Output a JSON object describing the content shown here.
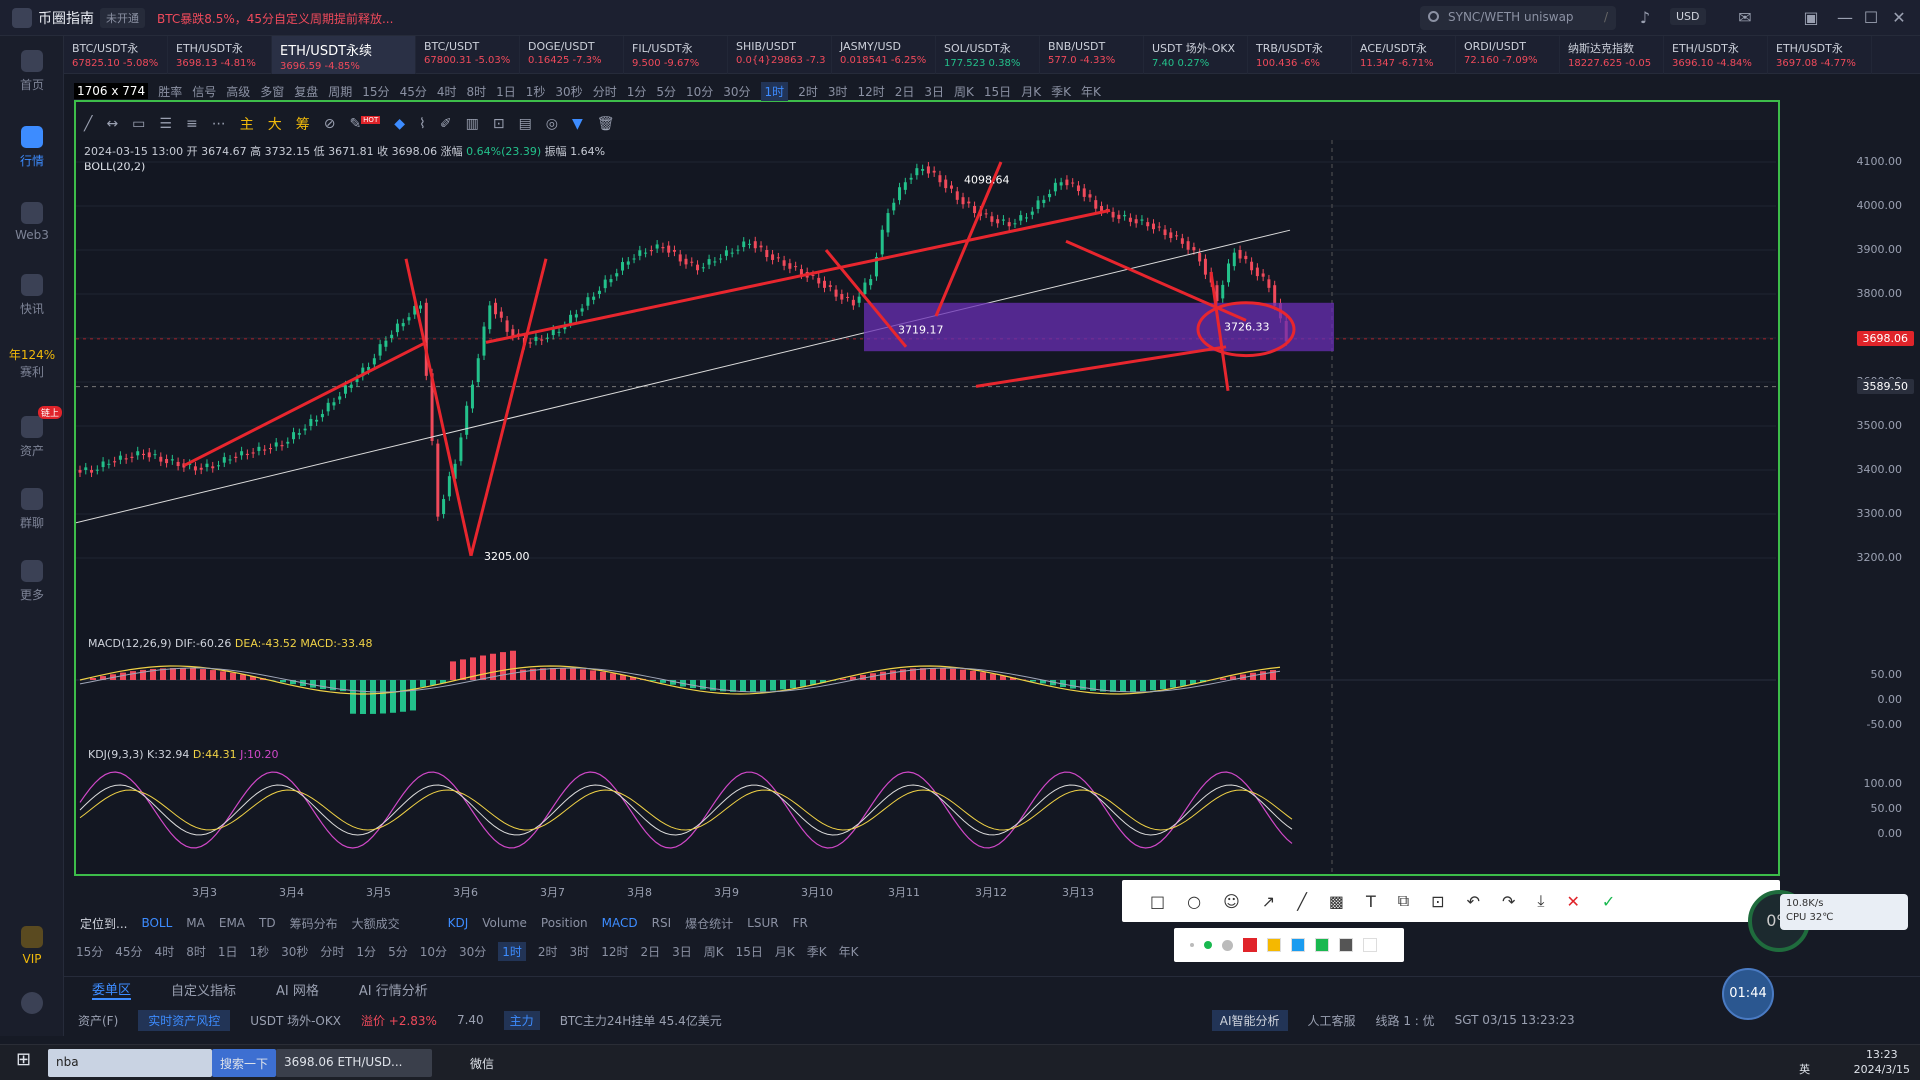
{
  "app": {
    "title": "币圈指南",
    "status": "未开通",
    "news": "BTC暴跌8.5%，45分自定义周期提前释放...",
    "search_placeholder": "SYNC/WETH uniswap",
    "search_shortcut": "/",
    "currency": "USD"
  },
  "nav": [
    {
      "label": "首页",
      "icon": "home-icon"
    },
    {
      "label": "行情",
      "icon": "chart-icon",
      "active": true
    },
    {
      "label": "Web3",
      "icon": "web3-icon"
    },
    {
      "label": "快讯",
      "icon": "news-icon"
    },
    {
      "label": "年124%",
      "sub": "赛利",
      "icon": "apy-icon"
    },
    {
      "label": "资产",
      "icon": "wallet-icon",
      "badge": "链上"
    },
    {
      "label": "群聊",
      "icon": "chat-icon"
    },
    {
      "label": "更多",
      "icon": "grid-icon"
    },
    {
      "label": "VIP",
      "icon": "vip-icon"
    }
  ],
  "tabs": [
    {
      "name": "BTC/USDT永",
      "price": "67825.10",
      "change": "-5.08%",
      "dir": "dn"
    },
    {
      "name": "ETH/USDT永",
      "price": "3698.13",
      "change": "-4.81%",
      "dir": "dn"
    },
    {
      "name": "ETH/USDT永续",
      "price": "3696.59",
      "change": "-4.85%",
      "dir": "dn",
      "active": true
    },
    {
      "name": "BTC/USDT",
      "price": "67800.31",
      "change": "-5.03%",
      "dir": "dn"
    },
    {
      "name": "DOGE/USDT",
      "price": "0.16425",
      "change": "-7.3%",
      "dir": "dn"
    },
    {
      "name": "FIL/USDT永",
      "price": "9.500",
      "change": "-9.67%",
      "dir": "dn"
    },
    {
      "name": "SHIB/USDT",
      "price": "0.0{4}29863",
      "change": "-7.3",
      "dir": "dn"
    },
    {
      "name": "JASMY/USD",
      "price": "0.018541",
      "change": "-6.25%",
      "dir": "dn"
    },
    {
      "name": "SOL/USDT永",
      "price": "177.523",
      "change": "0.38%",
      "dir": "up"
    },
    {
      "name": "BNB/USDT",
      "price": "577.0",
      "change": "-4.33%",
      "dir": "dn"
    },
    {
      "name": "USDT 场外-OKX",
      "price": "7.40",
      "change": "0.27%",
      "dir": "up"
    },
    {
      "name": "TRB/USDT永",
      "price": "100.436",
      "change": "-6%",
      "dir": "dn"
    },
    {
      "name": "ACE/USDT永",
      "price": "11.347",
      "change": "-6.71%",
      "dir": "dn"
    },
    {
      "name": "ORDI/USDT",
      "price": "72.160",
      "change": "-7.09%",
      "dir": "dn"
    },
    {
      "name": "纳斯达克指数",
      "price": "18227.625",
      "change": "-0.05",
      "dir": "dn"
    },
    {
      "name": "ETH/USDT永",
      "price": "3696.10",
      "change": "-4.84%",
      "dir": "dn"
    },
    {
      "name": "ETH/USDT永",
      "price": "3697.08",
      "change": "-4.77%",
      "dir": "dn"
    }
  ],
  "toolbar": {
    "size": "1706 x 774",
    "items": [
      "胜率",
      "信号",
      "高级",
      "多窗",
      "复盘",
      "周期"
    ],
    "periods": [
      "15分",
      "45分",
      "4时",
      "8时",
      "1日",
      "1秒",
      "30秒",
      "分时",
      "1分",
      "5分",
      "10分",
      "30分",
      "1时",
      "2时",
      "3时",
      "12时",
      "2日",
      "3日",
      "周K",
      "15日",
      "月K",
      "季K",
      "年K"
    ],
    "selected_period": "1时",
    "draw_labels": [
      "主",
      "大",
      "筹"
    ],
    "hot": "HOT"
  },
  "ohlc": {
    "date": "2024-03-15 13:00",
    "open": "3674.67",
    "high": "3732.15",
    "low": "3671.81",
    "close": "3698.06",
    "change": "0.64%(23.39)",
    "amp": "1.64%",
    "boll": "BOLL(20,2)"
  },
  "chart_data": {
    "type": "candlestick",
    "pair": "ETH/USDT",
    "ylim": [
      3150,
      4150
    ],
    "y_ticks": [
      "4100.00",
      "4000.00",
      "3900.00",
      "3800.00",
      "3700.00",
      "3600.00",
      "3500.00",
      "3400.00",
      "3300.00",
      "3200.00"
    ],
    "x_ticks": [
      "3月3",
      "3月4",
      "3月5",
      "3月6",
      "3月7",
      "3月8",
      "3月9",
      "3月10",
      "3月11",
      "3月12",
      "3月13"
    ],
    "last_price": "3698.06",
    "cross_price": "3589.50",
    "annotations": [
      "4098.64",
      "3205.00",
      "3719.17",
      "3726.33"
    ],
    "close_series": [
      3400,
      3420,
      3430,
      3440,
      3425,
      3415,
      3405,
      3410,
      3430,
      3440,
      3450,
      3460,
      3490,
      3520,
      3560,
      3600,
      3640,
      3700,
      3740,
      3780,
      3300,
      3420,
      3600,
      3780,
      3720,
      3690,
      3700,
      3720,
      3760,
      3800,
      3840,
      3880,
      3900,
      3910,
      3880,
      3860,
      3880,
      3900,
      3920,
      3890,
      3870,
      3850,
      3830,
      3800,
      3780,
      3840,
      3990,
      4060,
      4090,
      4060,
      4020,
      3990,
      3970,
      3960,
      3980,
      4020,
      4060,
      4040,
      4000,
      3980,
      3970,
      3960,
      3940,
      3920,
      3880,
      3790,
      3900,
      3860,
      3820,
      3698
    ],
    "macd": {
      "label": "MACD(12,26,9)",
      "dif": "DIF:-60.26",
      "dea": "DEA:-43.52",
      "macd": "MACD:-33.48",
      "ticks": [
        "50.00",
        "0.00",
        "-50.00"
      ]
    },
    "kdj": {
      "label": "KDJ(9,3,3)",
      "k": "K:32.94",
      "d": "D:44.31",
      "j": "J:10.20",
      "ticks": [
        "100.00",
        "50.00",
        "0.00"
      ]
    }
  },
  "indicators": {
    "prefix": "定位到...",
    "items": [
      "BOLL",
      "MA",
      "EMA",
      "TD",
      "筹码分布",
      "大额成交"
    ],
    "sub_items": [
      "KDJ",
      "Volume",
      "Position",
      "MACD",
      "RSI",
      "爆仓统计",
      "LSUR",
      "FR"
    ]
  },
  "bottom_tabs": [
    "委单区",
    "自定义指标",
    "AI 网格",
    "AI 行情分析"
  ],
  "status": {
    "asset": "资产(F)",
    "risk": "实时资产风控",
    "pair": "USDT 场外-OKX",
    "premium": "溢价 +2.83%",
    "price": "7.40",
    "main": "主力",
    "info": "BTC主力24H挂单 45.4亿美元",
    "ai": "AI智能分析",
    "service": "人工客服",
    "line": "线路 1 : 优",
    "time": "SGT 03/15 13:23:23"
  },
  "snap": {
    "colors": [
      "#e0242a",
      "#f5b800",
      "#1a9cf0",
      "#19b84f",
      "#555555",
      "#ffffff"
    ]
  },
  "floating": {
    "pct": "0%",
    "timer": "01:44",
    "net_speed": "10.8K/s",
    "cpu": "CPU 32℃"
  },
  "taskbar": {
    "search": "nba",
    "search_btn": "搜索一下",
    "app1": "3698.06 ETH/USD...",
    "app2": "微信",
    "clock": "13:23",
    "date": "2024/3/15",
    "ime": "英"
  }
}
